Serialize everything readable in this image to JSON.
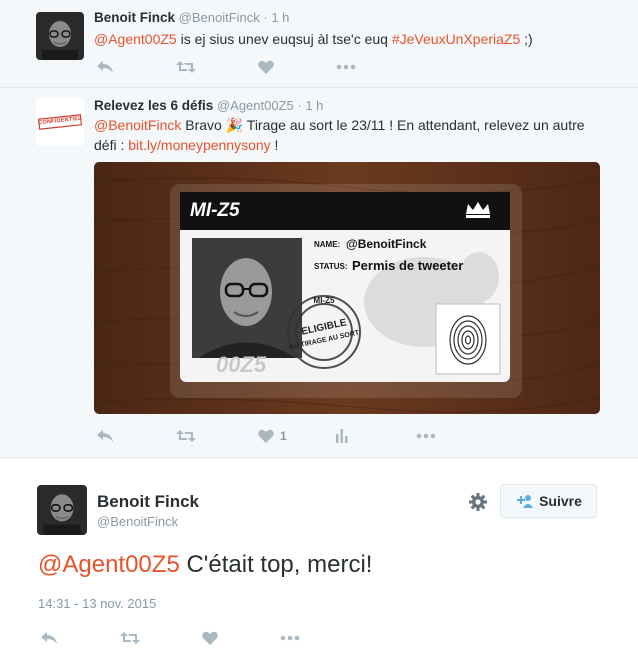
{
  "tweets": [
    {
      "name": "Benoit Finck",
      "handle": "@BenoitFinck",
      "time": "· 1 h",
      "mention": "@Agent00Z5",
      "body": " is ej sius unev euqsuj àl tse'c euq ",
      "hashtag": "#JeVeuxUnXperiaZ5",
      "end": " ;)"
    },
    {
      "name": "Relevez les 6 défis",
      "handle": "@Agent00Z5",
      "time": "· 1 h",
      "mention": "@BenoitFinck",
      "body_before_emoji": " Bravo ",
      "emoji": "🎉",
      "body_after_emoji": " Tirage au sort le 23/11 ! En attendant, relevez un autre défi : ",
      "link": "bit.ly/moneypennysony",
      "end": " !",
      "like_count": "1",
      "avatar_stamp": "CONFIDENTIEL"
    }
  ],
  "card": {
    "brand": "MI-Z5",
    "name_label": "NAME:",
    "name_value": "@BenoitFinck",
    "status_label": "STATUS:",
    "status_value": "Permis de tweeter",
    "code": "00Z5",
    "stamp_top": "MI-Z5",
    "stamp_main": "ELIGIBLE",
    "stamp_bottom": "AU TIRAGE AU SORT"
  },
  "main": {
    "name": "Benoit Finck",
    "handle": "@BenoitFinck",
    "follow_label": "Suivre",
    "mention": "@Agent00Z5",
    "text": " C'était top, merci!",
    "timestamp": "14:31 - 13 nov. 2015"
  },
  "icons": [
    "reply-icon",
    "retweet-icon",
    "heart-icon",
    "more-icon",
    "analytics-icon",
    "gear-icon",
    "follow-person-icon",
    "crown-icon",
    "fingerprint-icon"
  ],
  "colors": {
    "link": "#e8522b",
    "muted": "#8899a6",
    "action": "#aab8c2",
    "text": "#292f33"
  }
}
